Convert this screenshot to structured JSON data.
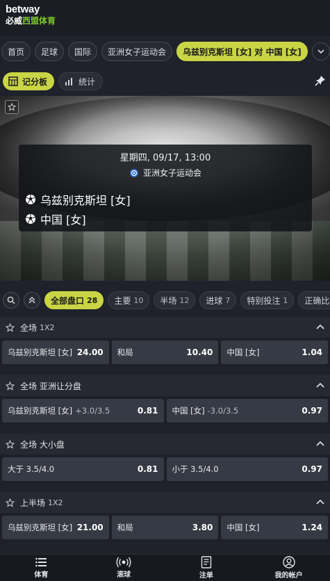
{
  "logo": {
    "top": "betway",
    "bottom_a": "必威",
    "bottom_b": "西盟体育"
  },
  "breadcrumbs": [
    "首页",
    "足球",
    "国际",
    "亚洲女子运动会",
    "乌兹别克斯坦 [女] 对 中国 [女]"
  ],
  "view_tabs": {
    "scoreboard": "记分板",
    "stats": "统计"
  },
  "match": {
    "datetime": "星期四, 09/17, 13:00",
    "competition": "亚洲女子运动会",
    "home": "乌兹别克斯坦 [女]",
    "away": "中国 [女]"
  },
  "filters": [
    {
      "label": "全部盘口",
      "count": "28"
    },
    {
      "label": "主要",
      "count": "10"
    },
    {
      "label": "半场",
      "count": "12"
    },
    {
      "label": "进球",
      "count": "7"
    },
    {
      "label": "特别投注",
      "count": "1"
    },
    {
      "label": "正确比分",
      "count": ""
    }
  ],
  "markets": [
    {
      "title": "全场",
      "sub": "1X2",
      "odds": [
        {
          "label": "乌兹别克斯坦 [女]",
          "line": "",
          "price": "24.00"
        },
        {
          "label": "和局",
          "line": "",
          "price": "10.40"
        },
        {
          "label": "中国 [女]",
          "line": "",
          "price": "1.04"
        }
      ]
    },
    {
      "title": "全场 亚洲让分盘",
      "sub": "",
      "odds": [
        {
          "label": "乌兹别克斯坦 [女]",
          "line": "+3.0/3.5",
          "price": "0.81"
        },
        {
          "label": "中国 [女]",
          "line": "-3.0/3.5",
          "price": "0.97"
        }
      ]
    },
    {
      "title": "全场 大小盘",
      "sub": "",
      "odds": [
        {
          "label": "大于 3.5/4.0",
          "line": "",
          "price": "0.81"
        },
        {
          "label": "小于 3.5/4.0",
          "line": "",
          "price": "0.97"
        }
      ]
    },
    {
      "title": "上半场",
      "sub": "1X2",
      "odds": [
        {
          "label": "乌兹别克斯坦 [女]",
          "line": "",
          "price": "21.00"
        },
        {
          "label": "和局",
          "line": "",
          "price": "3.80"
        },
        {
          "label": "中国 [女]",
          "line": "",
          "price": "1.24"
        }
      ]
    }
  ],
  "bottom_nav": [
    "体育",
    "滚球",
    "注单",
    "我的帐户"
  ],
  "colors": {
    "accent": "#c9d545",
    "brand_green": "#7cc52c",
    "background": "#1f222a"
  }
}
